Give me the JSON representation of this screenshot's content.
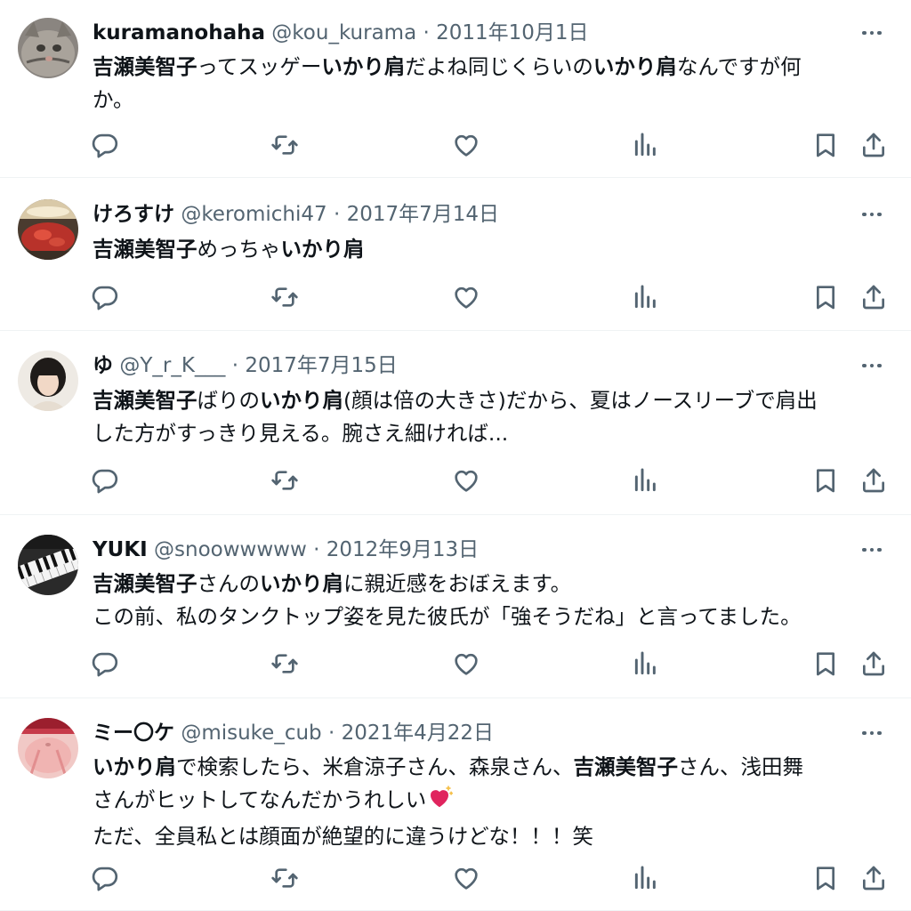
{
  "tweets": [
    {
      "name": "kuramanohaha",
      "handle": "@kou_kurama",
      "sep": " · ",
      "date": "2011年10月1日",
      "lines": [
        [
          {
            "t": "吉瀬美智子",
            "b": true
          },
          {
            "t": "ってスッゲー",
            "b": false
          },
          {
            "t": "いかり肩",
            "b": true
          },
          {
            "t": "だよね同じくらいの",
            "b": false
          },
          {
            "t": "いかり肩",
            "b": true
          },
          {
            "t": "なんですが何",
            "b": false
          }
        ],
        [
          {
            "t": "か。",
            "b": false
          }
        ]
      ]
    },
    {
      "name": "けろすけ",
      "handle": "@keromichi47",
      "sep": " · ",
      "date": "2017年7月14日",
      "lines": [
        [
          {
            "t": "吉瀬美智子",
            "b": true
          },
          {
            "t": "めっちゃ",
            "b": false
          },
          {
            "t": "いかり肩",
            "b": true
          }
        ]
      ]
    },
    {
      "name": "ゆ",
      "handle": "@Y_r_K___",
      "sep": " · ",
      "date": "2017年7月15日",
      "lines": [
        [
          {
            "t": "吉瀬美智子",
            "b": true
          },
          {
            "t": "ばりの",
            "b": false
          },
          {
            "t": "いかり肩",
            "b": true
          },
          {
            "t": "(顔は倍の大きさ)だから、夏はノースリーブで肩出",
            "b": false
          }
        ],
        [
          {
            "t": "した方がすっきり見える。腕さえ細ければ...",
            "b": false
          }
        ]
      ]
    },
    {
      "name": "YUKI",
      "handle": "@snoowwwww",
      "sep": " · ",
      "date": "2012年9月13日",
      "lines": [
        [
          {
            "t": "吉瀬美智子",
            "b": true
          },
          {
            "t": "さんの",
            "b": false
          },
          {
            "t": "いかり肩",
            "b": true
          },
          {
            "t": "に親近感をおぼえます。",
            "b": false
          }
        ],
        [
          {
            "t": "この前、私のタンクトップ姿を見た彼氏が「強そうだね」と言ってました。",
            "b": false
          }
        ]
      ]
    },
    {
      "name": "ミー〇ケ",
      "handle": "@misuke_cub",
      "sep": " · ",
      "date": "2021年4月22日",
      "lines": [
        [
          {
            "t": "いかり肩",
            "b": true
          },
          {
            "t": "で検索したら、米倉涼子さん、森泉さん、",
            "b": false
          },
          {
            "t": "吉瀬美智子",
            "b": true
          },
          {
            "t": "さん、浅田舞",
            "b": false
          }
        ],
        [
          {
            "t": "さんがヒットしてなんだかうれしい",
            "b": false
          },
          {
            "icon": "sparkling-heart-icon"
          }
        ],
        [
          {
            "t": "ただ、全員私とは顔面が絶望的に違うけどな！！！笑",
            "b": false
          }
        ]
      ]
    }
  ],
  "icons": {
    "actions": [
      "reply-icon",
      "retweet-icon",
      "like-icon",
      "views-icon",
      "bookmark-icon",
      "share-icon"
    ],
    "more": "more-icon"
  },
  "colors": {
    "text": "#0f1419",
    "secondary": "#536471",
    "divider": "#eff3f4",
    "heart": "#e0245e"
  }
}
